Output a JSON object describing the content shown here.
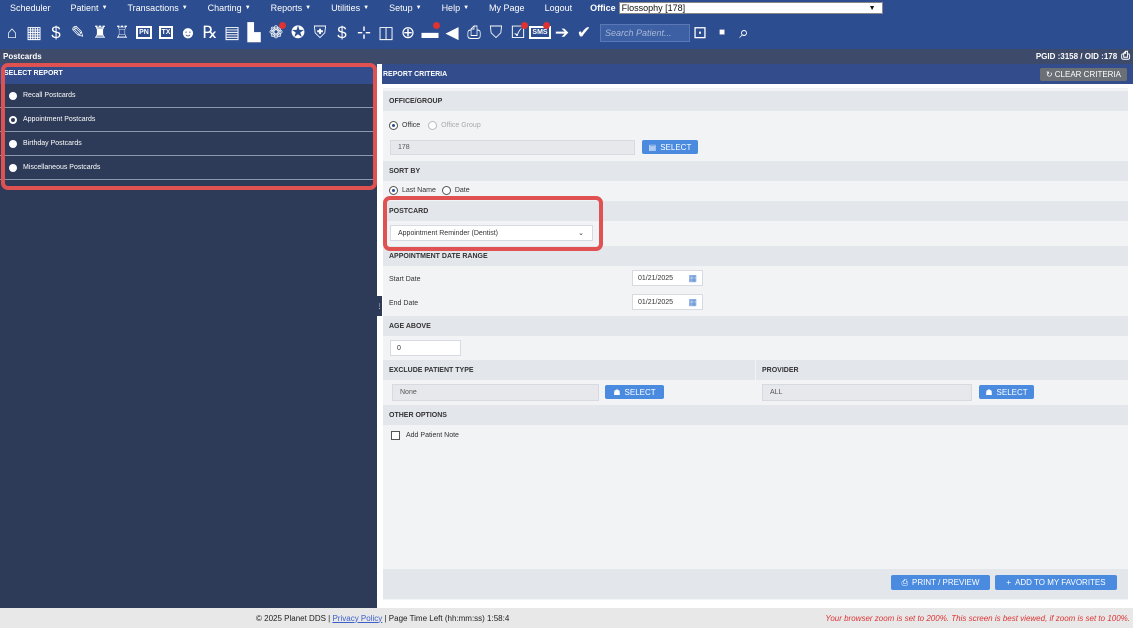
{
  "nav": {
    "items": [
      {
        "label": "Scheduler",
        "caret": false
      },
      {
        "label": "Patient",
        "caret": true
      },
      {
        "label": "Transactions",
        "caret": true
      },
      {
        "label": "Charting",
        "caret": true
      },
      {
        "label": "Reports",
        "caret": true
      },
      {
        "label": "Utilities",
        "caret": true
      },
      {
        "label": "Setup",
        "caret": true
      },
      {
        "label": "Help",
        "caret": true
      },
      {
        "label": "My Page",
        "caret": false
      },
      {
        "label": "Logout",
        "caret": false
      }
    ],
    "office_label": "Office",
    "office_value": "Flossophy [178]"
  },
  "toolbar": {
    "search_placeholder": "Search Patient...",
    "tx_label": "TX",
    "pn_label": "PN",
    "sms_label": "SMS"
  },
  "page": {
    "title": "Postcards",
    "ids": "PGID :3158 / OID :178"
  },
  "left": {
    "header": "SELECT REPORT",
    "items": [
      {
        "label": "Recall Postcards",
        "selected": false
      },
      {
        "label": "Appointment Postcards",
        "selected": true
      },
      {
        "label": "Birthday Postcards",
        "selected": false
      },
      {
        "label": "Miscellaneous Postcards",
        "selected": false
      }
    ]
  },
  "right": {
    "header": "REPORT CRITERIA",
    "clear_label": "CLEAR CRITERIA",
    "office_group": {
      "title": "OFFICE/GROUP",
      "opt_office": "Office",
      "opt_group": "Office Group",
      "value": "178",
      "select_label": "SELECT"
    },
    "sort_by": {
      "title": "SORT BY",
      "opt_last": "Last Name",
      "opt_date": "Date"
    },
    "postcard": {
      "title": "POSTCARD",
      "value": "Appointment Reminder (Dentist)"
    },
    "date_range": {
      "title": "APPOINTMENT DATE RANGE",
      "start_label": "Start Date",
      "start_value": "01/21/2025",
      "end_label": "End Date",
      "end_value": "01/21/2025"
    },
    "age": {
      "title": "AGE ABOVE",
      "value": "0"
    },
    "exclude": {
      "title": "EXCLUDE PATIENT TYPE",
      "value": "None",
      "select_label": "SELECT"
    },
    "provider": {
      "title": "PROVIDER",
      "value": "ALL",
      "select_label": "SELECT"
    },
    "other": {
      "title": "OTHER OPTIONS",
      "add_note": "Add Patient Note"
    },
    "print_label": "PRINT / PREVIEW",
    "fav_label": "ADD TO MY FAVORITES"
  },
  "footer": {
    "copyright": "© 2025 Planet DDS |",
    "privacy": "Privacy Policy",
    "time_left": "| Page Time Left (hh:mm:ss) 1:58:4",
    "warning": "Your browser zoom is set to 200%. This screen is best viewed, if zoom is set to 100%."
  }
}
